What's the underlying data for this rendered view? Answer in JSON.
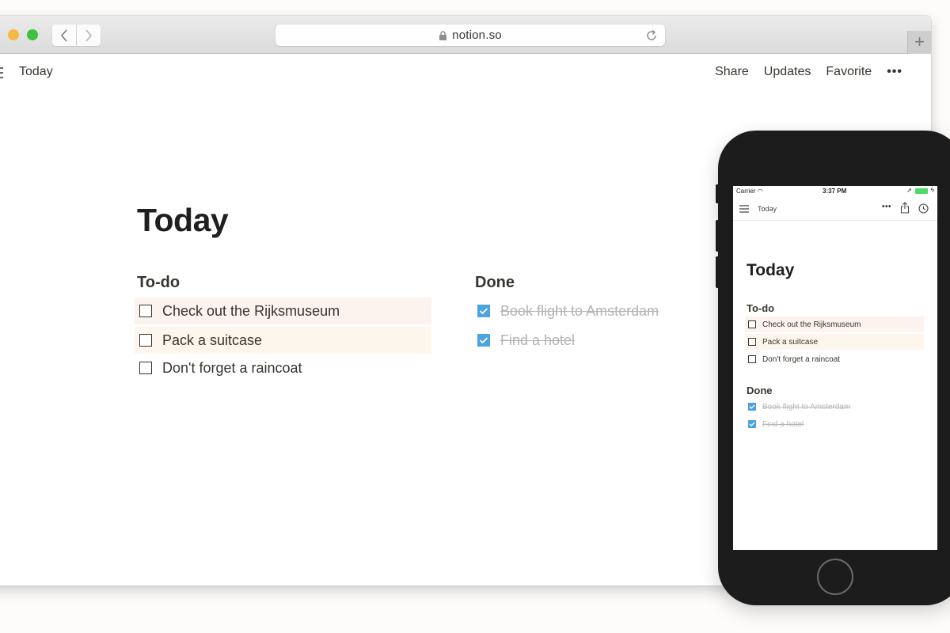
{
  "browser": {
    "url": "notion.so",
    "new_tab_label": "+"
  },
  "header": {
    "breadcrumb": "Today",
    "actions": [
      "Share",
      "Updates",
      "Favorite"
    ],
    "more": "•••"
  },
  "page": {
    "title": "Today",
    "todo": {
      "heading": "To-do",
      "items": [
        {
          "text": "Check out the Rijksmuseum",
          "checked": false,
          "highlight": "#fcf3ef"
        },
        {
          "text": "Pack a suitcase",
          "checked": false,
          "highlight": "#fdf6ec"
        },
        {
          "text": "Don't forget a raincoat",
          "checked": false,
          "highlight": null
        }
      ]
    },
    "done": {
      "heading": "Done",
      "items": [
        {
          "text": "Book flight to Amsterdam",
          "checked": true
        },
        {
          "text": "Find a hotel",
          "checked": true
        }
      ]
    }
  },
  "phone": {
    "status": {
      "carrier": "Carrier",
      "time": "3:37 PM"
    },
    "breadcrumb": "Today",
    "more": "•••",
    "title": "Today"
  },
  "colors": {
    "checkbox_checked": "#4ba3df",
    "highlight_red": "#fcf3ef",
    "highlight_yellow": "#fdf6ec",
    "battery": "#4cd964"
  }
}
